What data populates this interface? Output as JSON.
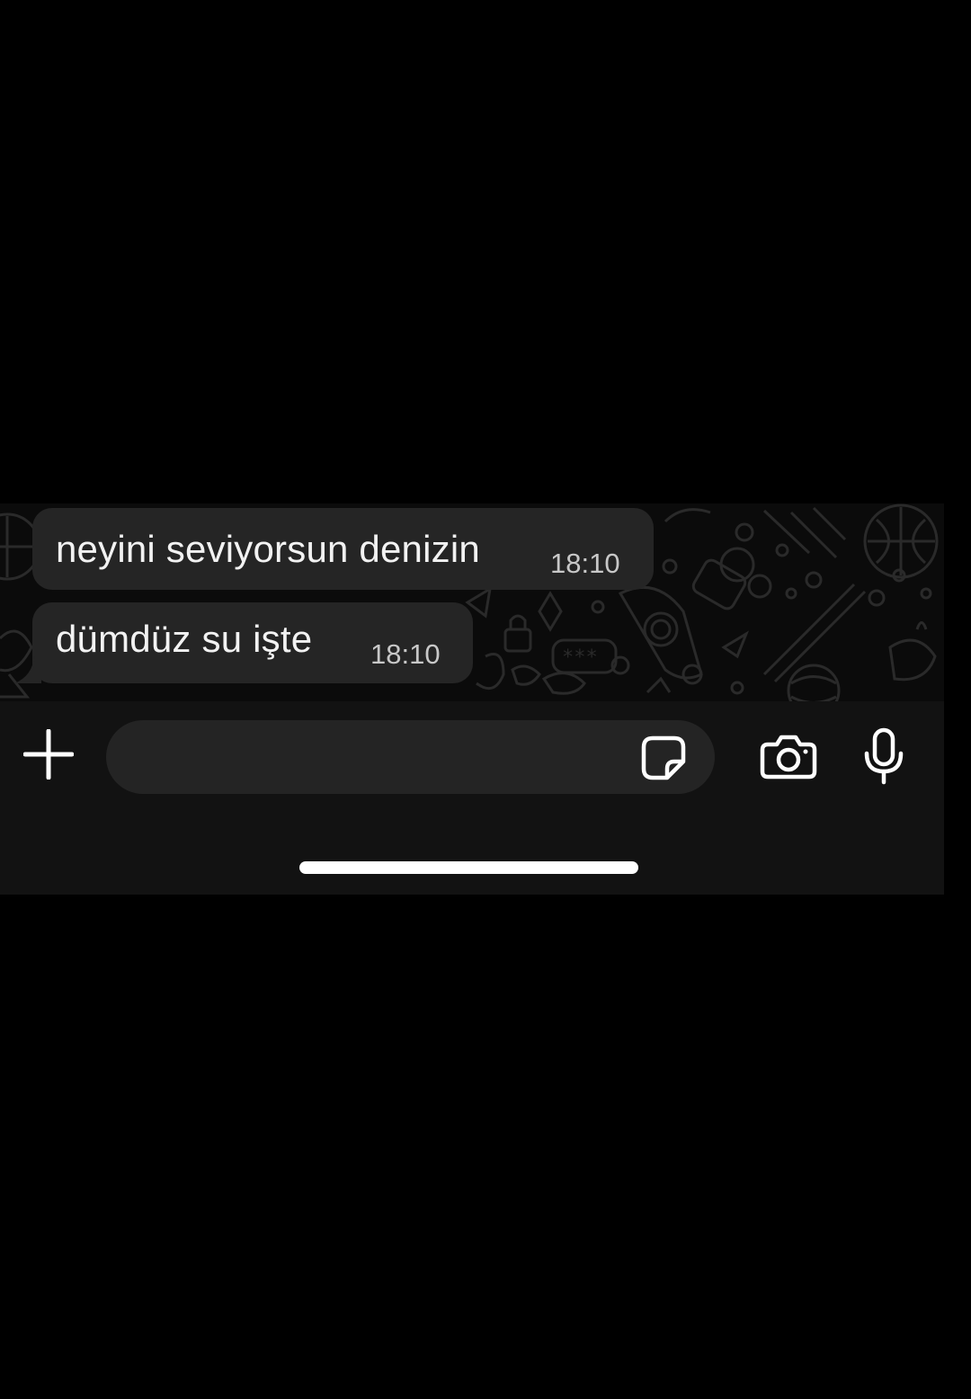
{
  "messages": [
    {
      "text": "neyini seviyorsun denizin",
      "time": "18:10"
    },
    {
      "text": "dümdüz su işte",
      "time": "18:10"
    }
  ],
  "composer": {
    "placeholder": "",
    "icons": [
      "plus-icon",
      "sticker-icon",
      "camera-icon",
      "microphone-icon"
    ]
  },
  "colors": {
    "background": "#000000",
    "chat_background": "#0b0b0b",
    "bubble": "#252525",
    "input": "#242424",
    "text": "#f2f2f2",
    "time": "#c8c8c8"
  }
}
